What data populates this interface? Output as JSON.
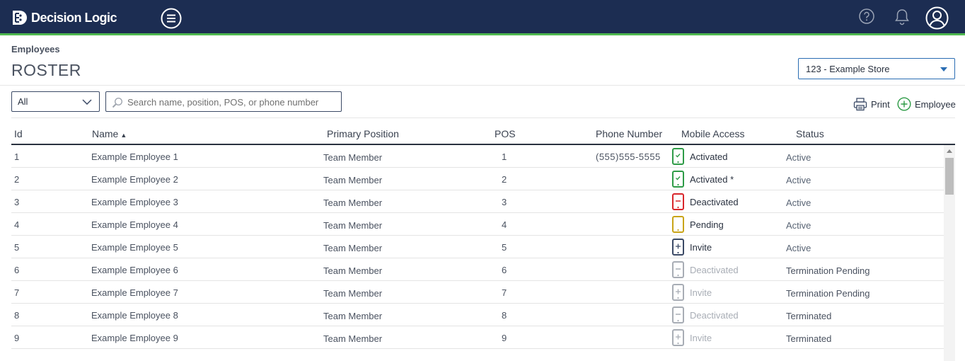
{
  "header": {
    "logo_text": "Decision Logic"
  },
  "breadcrumb": "Employees",
  "page_title": "ROSTER",
  "store_select": {
    "value": "123 - Example Store"
  },
  "filter": {
    "value": "All"
  },
  "search": {
    "placeholder": "Search name, position, POS, or phone number",
    "value": ""
  },
  "actions": {
    "print_label": "Print",
    "add_label": "Employee"
  },
  "table": {
    "columns": {
      "id": "Id",
      "name": "Name",
      "primary_position": "Primary Position",
      "pos": "POS",
      "phone": "Phone Number",
      "mobile_access": "Mobile Access",
      "status": "Status"
    },
    "sort_indicator": "▲",
    "rows": [
      {
        "id": "1",
        "name": "Example Employee 1",
        "position": "Team Member",
        "pos": "1",
        "phone": "(555)555-5555",
        "mobile": "Activated",
        "mobile_state": "activated",
        "status": "Active"
      },
      {
        "id": "2",
        "name": "Example Employee 2",
        "position": "Team Member",
        "pos": "2",
        "phone": "",
        "mobile": "Activated *",
        "mobile_state": "activated",
        "status": "Active"
      },
      {
        "id": "3",
        "name": "Example Employee 3",
        "position": "Team Member",
        "pos": "3",
        "phone": "",
        "mobile": "Deactivated",
        "mobile_state": "deactivated",
        "status": "Active"
      },
      {
        "id": "4",
        "name": "Example Employee 4",
        "position": "Team Member",
        "pos": "4",
        "phone": "",
        "mobile": "Pending",
        "mobile_state": "pending",
        "status": "Active"
      },
      {
        "id": "5",
        "name": "Example Employee 5",
        "position": "Team Member",
        "pos": "5",
        "phone": "",
        "mobile": "Invite",
        "mobile_state": "invite",
        "status": "Active"
      },
      {
        "id": "6",
        "name": "Example Employee 6",
        "position": "Team Member",
        "pos": "6",
        "phone": "",
        "mobile": "Deactivated",
        "mobile_state": "deactivated-muted",
        "status": "Termination Pending"
      },
      {
        "id": "7",
        "name": "Example Employee 7",
        "position": "Team Member",
        "pos": "7",
        "phone": "",
        "mobile": "Invite",
        "mobile_state": "invite-muted",
        "status": "Termination Pending"
      },
      {
        "id": "8",
        "name": "Example Employee 8",
        "position": "Team Member",
        "pos": "8",
        "phone": "",
        "mobile": "Deactivated",
        "mobile_state": "deactivated-muted",
        "status": "Terminated"
      },
      {
        "id": "9",
        "name": "Example Employee 9",
        "position": "Team Member",
        "pos": "9",
        "phone": "",
        "mobile": "Invite",
        "mobile_state": "invite-muted",
        "status": "Terminated"
      }
    ]
  },
  "colors": {
    "header_bg": "#1c2d52",
    "accent_green": "#4fb84f",
    "activated": "#2e9b47",
    "deactivated": "#d8262b",
    "pending": "#c9a417",
    "invite": "#3b4a66",
    "muted": "#a8adb5"
  },
  "icons": {
    "logo": "decision-logic-logo-icon",
    "menu": "hamburger-menu-icon",
    "help": "help-icon",
    "bell": "bell-icon",
    "user": "user-account-icon",
    "search": "search-icon",
    "print": "printer-icon",
    "add": "plus-circle-icon",
    "chevron": "chevron-down-icon"
  }
}
